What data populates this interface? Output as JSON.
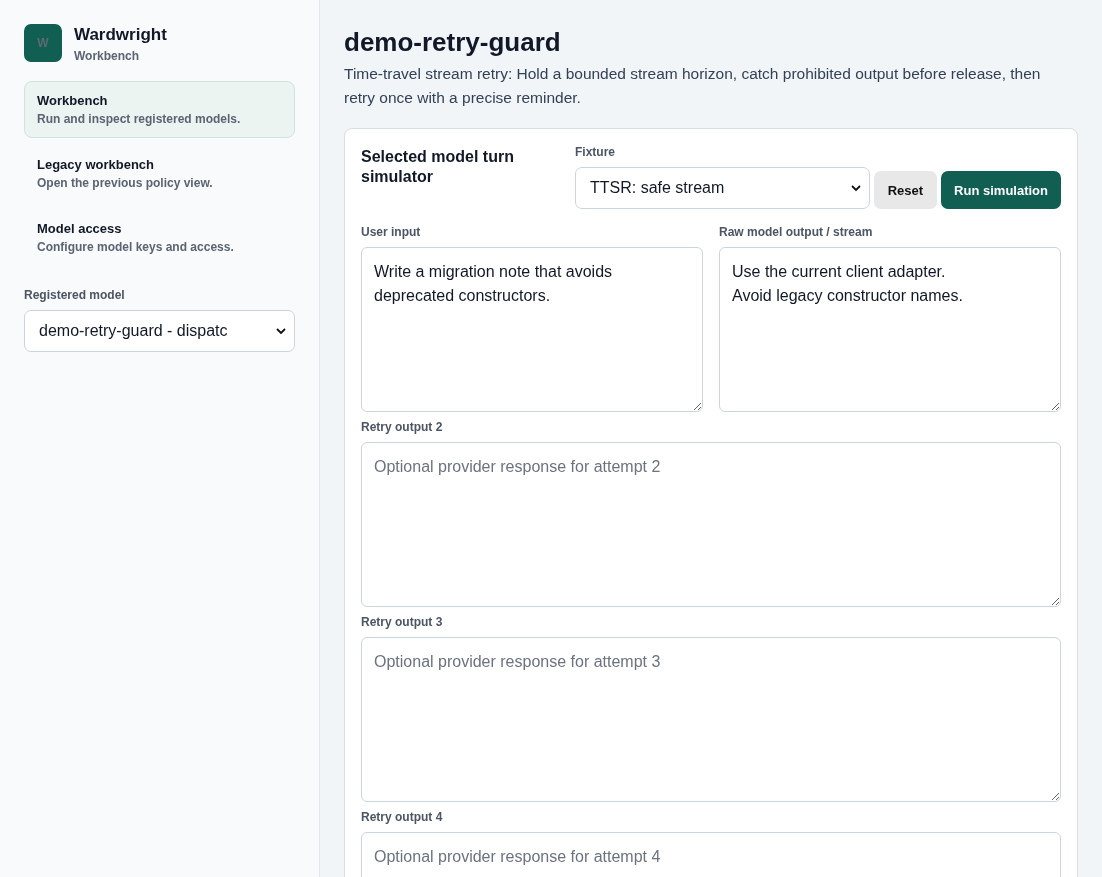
{
  "brand": {
    "logo_letter": "W",
    "name": "Wardwright",
    "subtitle": "Workbench"
  },
  "nav": [
    {
      "title": "Workbench",
      "description": "Run and inspect registered models.",
      "selected": true
    },
    {
      "title": "Legacy workbench",
      "description": "Open the previous policy view.",
      "selected": false
    },
    {
      "title": "Model access",
      "description": "Configure model keys and access.",
      "selected": false
    }
  ],
  "registered_model": {
    "label": "Registered model",
    "value": "demo-retry-guard - dispatc"
  },
  "page": {
    "title": "demo-retry-guard",
    "description": "Time-travel stream retry: Hold a bounded stream horizon, catch prohibited output before release, then retry once with a precise reminder."
  },
  "simulator": {
    "title": "Selected model turn simulator",
    "fixture": {
      "label": "Fixture",
      "value": "TTSR: safe stream"
    },
    "buttons": [
      {
        "label": "Reset",
        "kind": "secondary"
      },
      {
        "label": "Run simulation",
        "kind": "primary"
      }
    ],
    "user_input": {
      "label": "User input",
      "value": "Write a migration note that avoids deprecated constructors."
    },
    "raw_output": {
      "label": "Raw model output / stream",
      "value": "Use the current client adapter.\nAvoid legacy constructor names."
    },
    "retry_outputs": [
      {
        "label": "Retry output 2",
        "placeholder": "Optional provider response for attempt 2"
      },
      {
        "label": "Retry output 3",
        "placeholder": "Optional provider response for attempt 3"
      },
      {
        "label": "Retry output 4",
        "placeholder": "Optional provider response for attempt 4"
      }
    ]
  }
}
